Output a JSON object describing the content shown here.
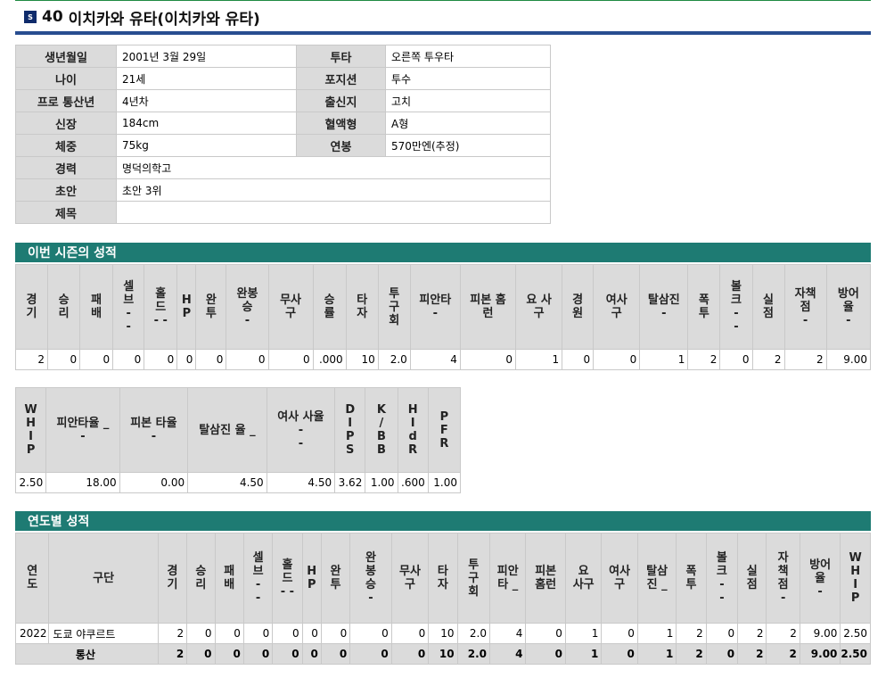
{
  "title": {
    "logo": "S",
    "number": "40",
    "name": "이치카와 유타(이치카와 유타)"
  },
  "profile": {
    "rows": [
      [
        "생년월일",
        "2001년 3월 29일",
        "투타",
        "오른쪽 투우타"
      ],
      [
        "나이",
        "21세",
        "포지션",
        "투수"
      ],
      [
        "프로 통산년",
        "4년차",
        "출신지",
        "고치"
      ],
      [
        "신장",
        "184cm",
        "혈액형",
        "A형"
      ],
      [
        "체중",
        "75kg",
        "연봉",
        "570만엔(추정)"
      ]
    ],
    "wide_rows": [
      [
        "경력",
        "명덕의학고"
      ],
      [
        "초안",
        "초안 3위"
      ],
      [
        "제목",
        ""
      ]
    ]
  },
  "season": {
    "heading": "이번 시즌의 성적",
    "headers1": [
      "경\n기",
      "승\n리",
      "패\n배",
      "셀\n브\n-\n-",
      "홀\n드\n- -",
      "H\nP",
      "완\n투",
      "완봉\n승\n-",
      "무사\n구",
      "승\n률",
      "타\n자",
      "투\n구\n회",
      "피안타\n-",
      "피본 홈\n런",
      "요 사\n구",
      "경\n원",
      "여사\n구",
      "탈삼진\n-",
      "폭\n투",
      "볼\n크\n-\n-",
      "실\n점",
      "자책\n점\n-",
      "방어\n율\n-"
    ],
    "values1": [
      "2",
      "0",
      "0",
      "0",
      "0",
      "0",
      "0",
      "0",
      "0",
      ".000",
      "10",
      "2.0",
      "4",
      "0",
      "1",
      "0",
      "0",
      "1",
      "2",
      "0",
      "2",
      "2",
      "9.00"
    ],
    "headers2": [
      "W\nH\nI\nP",
      "피안타율 _\n-",
      "피본 타율\n-",
      "탈삼진 율 _",
      "여사 사율\n-\n-",
      "D\nI\nP\nS",
      "K\n/\nB\nB",
      "H\nI\nd\nR",
      "P\nF\nR"
    ],
    "values2": [
      "2.50",
      "18.00",
      "0.00",
      "4.50",
      "4.50",
      "3.62",
      "1.00",
      ".600",
      "1.00"
    ]
  },
  "yearly": {
    "heading": "연도별 성적",
    "headers": [
      "연\n도",
      "구단",
      "경\n기",
      "승\n리",
      "패\n배",
      "셀\n브\n-\n-",
      "홀\n드\n- -",
      "H\nP",
      "완\n투",
      "완\n봉\n승\n-",
      "무사\n구",
      "타\n자",
      "투\n구\n회",
      "피안\n타 _",
      "피본\n홈런",
      "요\n사구",
      "여사\n구",
      "탈삼\n진 _",
      "폭\n투",
      "볼\n크\n-\n-",
      "실\n점",
      "자\n책\n점\n-",
      "방어\n율\n-",
      "W\nH\nI\nP"
    ],
    "rows": [
      [
        "2022",
        "도쿄 야쿠르트",
        "2",
        "0",
        "0",
        "0",
        "0",
        "0",
        "0",
        "0",
        "0",
        "10",
        "2.0",
        "4",
        "0",
        "1",
        "0",
        "1",
        "2",
        "0",
        "2",
        "2",
        "9.00",
        "2.50"
      ]
    ],
    "total": [
      "통산",
      "2",
      "0",
      "0",
      "0",
      "0",
      "0",
      "0",
      "0",
      "0",
      "10",
      "2.0",
      "4",
      "0",
      "1",
      "0",
      "1",
      "2",
      "0",
      "2",
      "2",
      "9.00",
      "2.50"
    ]
  }
}
